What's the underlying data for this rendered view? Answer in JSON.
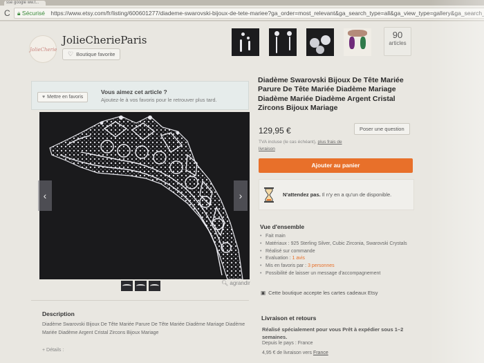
{
  "browser": {
    "tab_title": "sse google ww.t...",
    "secure_label": "Sécurisé",
    "url": "https://www.etsy.com/fr/listing/600601277/diademe-swarovski-bijoux-de-tete-mariee?ga_order=most_relevant&ga_search_type=all&ga_view_type=gallery&ga_search_query"
  },
  "shop": {
    "logo_text": "JolieCherie",
    "name": "JolieCherieParis",
    "favorite_button": "Boutique favorite",
    "item_count": "90",
    "item_count_label": "articles"
  },
  "favorites_banner": {
    "button": "Mettre en favoris",
    "title": "Vous aimez cet article ?",
    "subtitle": "Ajoutez-le à vos favoris pour le retrouver plus tard."
  },
  "gallery": {
    "zoom_label": "agrandir",
    "arrow_left": "‹",
    "arrow_right": "›"
  },
  "listing": {
    "title": "Diadème Swarovski Bijoux De Tête Mariée Parure De Tête Mariée Diadème Mariage Diadème Mariée Diadème Argent Cristal Zircons Bijoux Mariage",
    "price": "129,95 €",
    "ask_button": "Poser une question",
    "tax_note": "TVA incluse (le cas échéant),",
    "shipping_link": "plus frais de livraison",
    "add_to_cart": "Ajouter au panier",
    "scarcity_bold": "N'attendez pas.",
    "scarcity_rest": " Il n'y en a qu'un de disponible."
  },
  "overview": {
    "heading": "Vue d'ensemble",
    "items": [
      {
        "text": "Fait main",
        "highlight": ""
      },
      {
        "text": "Matériaux : 925 Sterling Silver, Cubic Zirconia, Swarovski Crystals",
        "highlight": ""
      },
      {
        "text": "Réalisé sur commande",
        "highlight": ""
      },
      {
        "text": "Evaluation : ",
        "highlight": "1 avis"
      },
      {
        "text": "Mis en favoris par : ",
        "highlight": "3 personnes"
      },
      {
        "text": "Possibilité de laisser un message d'accompagnement",
        "highlight": ""
      }
    ],
    "giftcard": "Cette boutique accepte les cartes cadeaux Etsy"
  },
  "description": {
    "heading": "Description",
    "text": "Diadème Swarovski Bijoux De Tête Mariée Parure De Tête Mariée Diadème Mariage Diadème Mariée Diadème Argent Cristal Zircons Bijoux Mariage",
    "details": "+ Détails :"
  },
  "shipping": {
    "heading": "Livraison et retours",
    "lead": "Réalisé spécialement pour vous Prêt à expédier sous 1–2 semaines.",
    "from": "Depuis le pays : France",
    "cost_prefix": "4,95 € de livraison vers ",
    "cost_dest": "France"
  },
  "colors": {
    "accent": "#e8702a",
    "page_bg": "#e9e7e1"
  }
}
